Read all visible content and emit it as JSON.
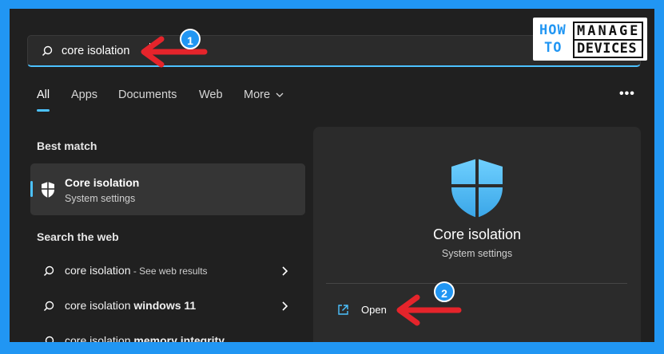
{
  "search": {
    "value": "core isolation"
  },
  "logo": {
    "how": "HOW",
    "to": "TO",
    "manage": "MANAGE",
    "devices": "DEVICES"
  },
  "tabs": [
    {
      "label": "All",
      "active": true
    },
    {
      "label": "Apps"
    },
    {
      "label": "Documents"
    },
    {
      "label": "Web"
    },
    {
      "label": "More"
    }
  ],
  "more_menu": "•••",
  "best_match": {
    "heading": "Best match",
    "title": "Core isolation",
    "subtitle": "System settings"
  },
  "search_web": {
    "heading": "Search the web",
    "results": [
      {
        "prefix": "core isolation",
        "bold": "",
        "hint": " - See web results"
      },
      {
        "prefix": "core isolation ",
        "bold": "windows 11",
        "hint": ""
      },
      {
        "prefix": "core isolation ",
        "bold": "memory integrity",
        "hint": ""
      }
    ]
  },
  "detail": {
    "title": "Core isolation",
    "subtitle": "System settings",
    "open_label": "Open"
  },
  "annotations": {
    "badge1": "1",
    "badge2": "2"
  },
  "colors": {
    "accent": "#4cc2ff",
    "background": "#2196f3",
    "arrow": "#e5242b"
  }
}
